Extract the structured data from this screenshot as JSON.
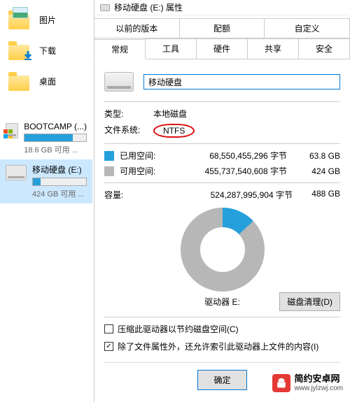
{
  "sidebar": {
    "quick": [
      {
        "label": "图片",
        "icon": "pictures"
      },
      {
        "label": "下载",
        "icon": "downloads"
      },
      {
        "label": "桌面",
        "icon": "desktop"
      }
    ],
    "drives": [
      {
        "name": "BOOTCAMP (...)",
        "free_text": "18.6 GB 可用 ...",
        "fill_pct": 78,
        "selected": false,
        "winlogo": true
      },
      {
        "name": "移动硬盘 (E:)",
        "free_text": "424 GB 可用 ...",
        "fill_pct": 14,
        "selected": true,
        "winlogo": false
      }
    ]
  },
  "dialog": {
    "title": "移动硬盘 (E:) 属性",
    "tabs_row1": [
      "以前的版本",
      "配额",
      "自定义"
    ],
    "tabs_row2": [
      "常规",
      "工具",
      "硬件",
      "共享",
      "安全"
    ],
    "active_tab": "常规",
    "drive_name_value": "移动硬盘",
    "type_label": "类型:",
    "type_value": "本地磁盘",
    "fs_label": "文件系统:",
    "fs_value": "NTFS",
    "used_label": "已用空间:",
    "used_bytes": "68,550,455,296 字节",
    "used_gb": "63.8 GB",
    "free_label": "可用空间:",
    "free_bytes": "455,737,540,608 字节",
    "free_gb": "424 GB",
    "capacity_label": "容量:",
    "capacity_bytes": "524,287,995,904 字节",
    "capacity_gb": "488 GB",
    "drive_letter_label": "驱动器 E:",
    "cleanup_btn": "磁盘清理(D)",
    "compress_label": "压缩此驱动器以节约磁盘空间(C)",
    "compress_checked": false,
    "index_label": "除了文件属性外，还允许索引此驱动器上文件的内容(I)",
    "index_checked": true,
    "ok_btn": "确定"
  },
  "watermark": {
    "title": "简约安卓网",
    "url": "www.jylzwj.com"
  }
}
